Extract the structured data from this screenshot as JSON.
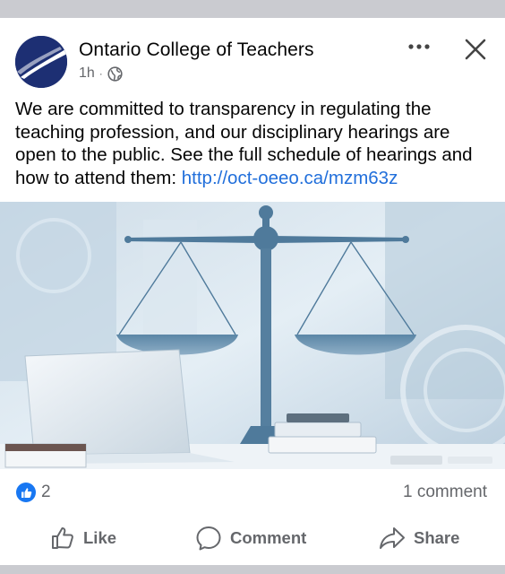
{
  "post": {
    "page_name": "Ontario College of Teachers",
    "time": "1h",
    "separator": "·",
    "audience_icon": "globe-icon",
    "text": "We are committed to transparency in regulating the teaching profession, and our disciplinary hearings are open to the public. See the full schedule of hearings and how to attend them: ",
    "link": "http://oct-oeeo.ca/mzm63z",
    "image_icon": "scales-of-justice-image"
  },
  "reactions": {
    "like_count": "2",
    "comment_count": "1 comment"
  },
  "actions": {
    "like_label": "Like",
    "comment_label": "Comment",
    "share_label": "Share"
  },
  "colors": {
    "link": "#216fdb",
    "like_badge": "#1877f2",
    "muted_text": "#65676b",
    "avatar_bg": "#1d2f73"
  }
}
